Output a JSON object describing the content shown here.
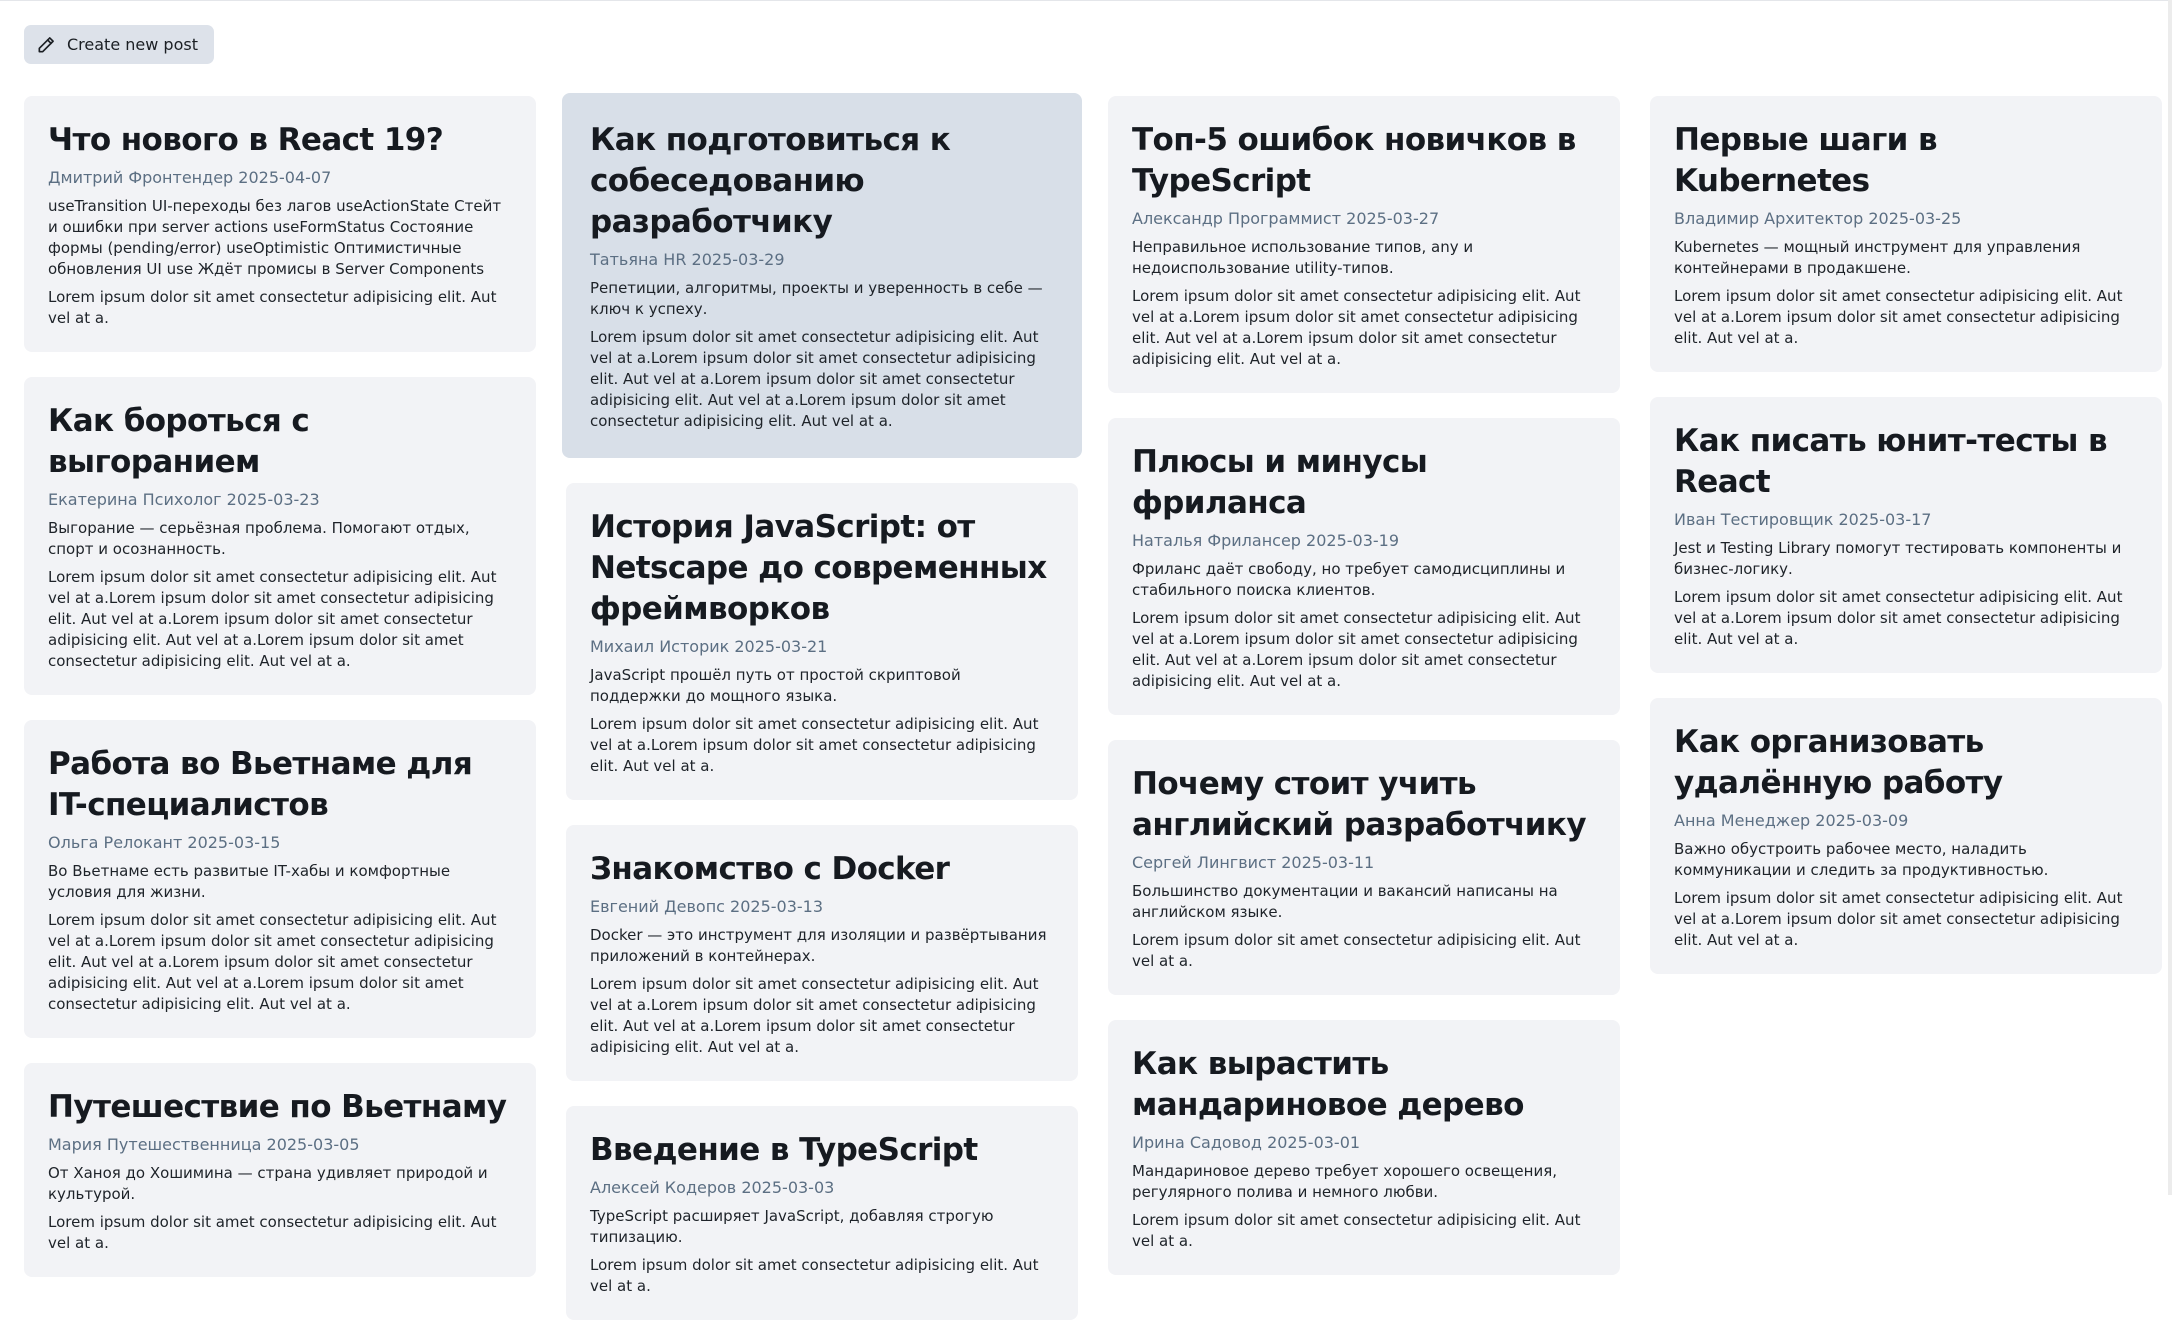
{
  "toolbar": {
    "create_label": "Create new post",
    "create_icon": "pencil-icon"
  },
  "colors": {
    "card_bg": "#f2f3f6",
    "card_hover_bg": "#d8dfe8",
    "meta_text": "#5c6f83",
    "button_bg": "#dde2ea"
  },
  "columns": [
    {
      "posts": [
        {
          "title": "Что нового в React 19?",
          "meta": "Дмитрий Фронтендер 2025-04-07",
          "summary": "useTransition UI-переходы без лагов useActionState Стейт и ошибки при server actions useFormStatus Состояние формы (pending/error) useOptimistic Оптимистичные обновления UI use Ждёт промисы в Server Components",
          "body": "Lorem ipsum dolor sit amet consectetur adipisicing elit. Aut vel at a."
        },
        {
          "title": "Как бороться с выгоранием",
          "meta": "Екатерина Психолог 2025-03-23",
          "summary": "Выгорание — серьёзная проблема. Помогают отдых, спорт и осознанность.",
          "body": "Lorem ipsum dolor sit amet consectetur adipisicing elit. Aut vel at a.Lorem ipsum dolor sit amet consectetur adipisicing elit. Aut vel at a.Lorem ipsum dolor sit amet consectetur adipisicing elit. Aut vel at a.Lorem ipsum dolor sit amet consectetur adipisicing elit. Aut vel at a."
        },
        {
          "title": "Работа во Вьетнаме для IT-специалистов",
          "meta": "Ольга Релокант 2025-03-15",
          "summary": "Во Вьетнаме есть развитые IT-хабы и комфортные условия для жизни.",
          "body": "Lorem ipsum dolor sit amet consectetur adipisicing elit. Aut vel at a.Lorem ipsum dolor sit amet consectetur adipisicing elit. Aut vel at a.Lorem ipsum dolor sit amet consectetur adipisicing elit. Aut vel at a.Lorem ipsum dolor sit amet consectetur adipisicing elit. Aut vel at a."
        },
        {
          "title": "Путешествие по Вьетнаму",
          "meta": "Мария Путешественница 2025-03-05",
          "summary": "От Ханоя до Хошимина — страна удивляет природой и культурой.",
          "body": "Lorem ipsum dolor sit amet consectetur adipisicing elit. Aut vel at a."
        }
      ]
    },
    {
      "posts": [
        {
          "title": "Как подготовиться к собеседованию разработчику",
          "meta": "Татьяна HR 2025-03-29",
          "summary": "Репетиции, алгоритмы, проекты и уверенность в себе — ключ к успеху.",
          "body": "Lorem ipsum dolor sit amet consectetur adipisicing elit. Aut vel at a.Lorem ipsum dolor sit amet consectetur adipisicing elit. Aut vel at a.Lorem ipsum dolor sit amet consectetur adipisicing elit. Aut vel at a.Lorem ipsum dolor sit amet consectetur adipisicing elit. Aut vel at a.",
          "hovered": true
        },
        {
          "title": "История JavaScript: от Netscape до современных фреймворков",
          "meta": "Михаил Историк 2025-03-21",
          "summary": "JavaScript прошёл путь от простой скриптовой поддержки до мощного языка.",
          "body": "Lorem ipsum dolor sit amet consectetur adipisicing elit. Aut vel at a.Lorem ipsum dolor sit amet consectetur adipisicing elit. Aut vel at a."
        },
        {
          "title": "Знакомство с Docker",
          "meta": "Евгений Девопс 2025-03-13",
          "summary": "Docker — это инструмент для изоляции и развёртывания приложений в контейнерах.",
          "body": "Lorem ipsum dolor sit amet consectetur adipisicing elit. Aut vel at a.Lorem ipsum dolor sit amet consectetur adipisicing elit. Aut vel at a.Lorem ipsum dolor sit amet consectetur adipisicing elit. Aut vel at a."
        },
        {
          "title": "Введение в TypeScript",
          "meta": "Алексей Кодеров 2025-03-03",
          "summary": "TypeScript расширяет JavaScript, добавляя строгую типизацию.",
          "body": "Lorem ipsum dolor sit amet consectetur adipisicing elit. Aut vel at a."
        }
      ]
    },
    {
      "posts": [
        {
          "title": "Топ-5 ошибок новичков в TypeScript",
          "meta": "Александр Программист 2025-03-27",
          "summary": "Неправильное использование типов, any и недоиспользование utility-типов.",
          "body": "Lorem ipsum dolor sit amet consectetur adipisicing elit. Aut vel at a.Lorem ipsum dolor sit amet consectetur adipisicing elit. Aut vel at a.Lorem ipsum dolor sit amet consectetur adipisicing elit. Aut vel at a."
        },
        {
          "title": "Плюсы и минусы фриланса",
          "meta": "Наталья Фрилансер 2025-03-19",
          "summary": "Фриланс даёт свободу, но требует самодисциплины и стабильного поиска клиентов.",
          "body": "Lorem ipsum dolor sit amet consectetur adipisicing elit. Aut vel at a.Lorem ipsum dolor sit amet consectetur adipisicing elit. Aut vel at a.Lorem ipsum dolor sit amet consectetur adipisicing elit. Aut vel at a."
        },
        {
          "title": "Почему стоит учить английский разработчику",
          "meta": "Сергей Лингвист 2025-03-11",
          "summary": "Большинство документации и вакансий написаны на английском языке.",
          "body": "Lorem ipsum dolor sit amet consectetur adipisicing elit. Aut vel at a."
        },
        {
          "title": "Как вырастить мандариновое дерево",
          "meta": "Ирина Садовод 2025-03-01",
          "summary": "Мандариновое дерево требует хорошего освещения, регулярного полива и немного любви.",
          "body": "Lorem ipsum dolor sit amet consectetur adipisicing elit. Aut vel at a."
        }
      ]
    },
    {
      "posts": [
        {
          "title": "Первые шаги в Kubernetes",
          "meta": "Владимир Архитектор 2025-03-25",
          "summary": "Kubernetes — мощный инструмент для управления контейнерами в продакшене.",
          "body": "Lorem ipsum dolor sit amet consectetur adipisicing elit. Aut vel at a.Lorem ipsum dolor sit amet consectetur adipisicing elit. Aut vel at a."
        },
        {
          "title": "Как писать юнит-тесты в React",
          "meta": "Иван Тестировщик 2025-03-17",
          "summary": "Jest и Testing Library помогут тестировать компоненты и бизнес-логику.",
          "body": "Lorem ipsum dolor sit amet consectetur adipisicing elit. Aut vel at a.Lorem ipsum dolor sit amet consectetur adipisicing elit. Aut vel at a."
        },
        {
          "title": "Как организовать удалённую работу",
          "meta": "Анна Менеджер 2025-03-09",
          "summary": "Важно обустроить рабочее место, наладить коммуникации и следить за продуктивностью.",
          "body": "Lorem ipsum dolor sit amet consectetur adipisicing elit. Aut vel at a.Lorem ipsum dolor sit amet consectetur adipisicing elit. Aut vel at a."
        }
      ]
    }
  ]
}
